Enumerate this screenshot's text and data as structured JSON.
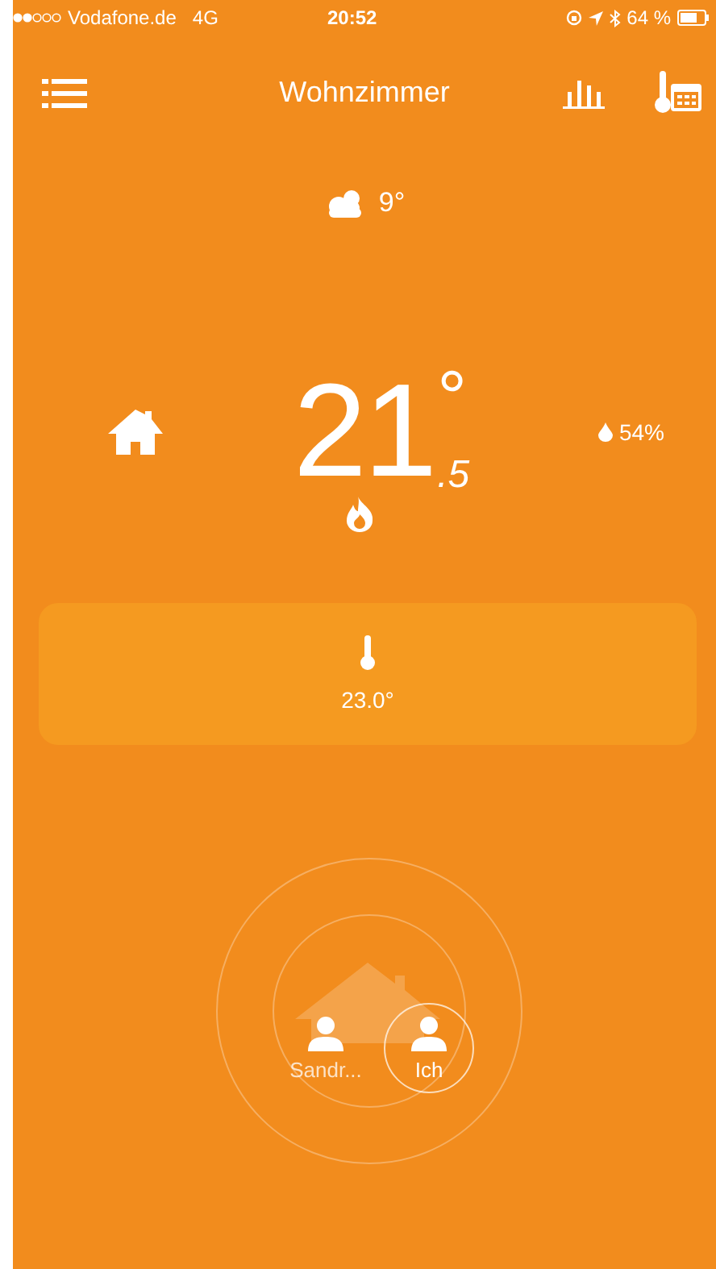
{
  "status_bar": {
    "carrier": "Vodafone.de",
    "network": "4G",
    "time": "20:52",
    "battery": "64 %"
  },
  "header": {
    "title": "Wohnzimmer"
  },
  "weather": {
    "temperature": "9°"
  },
  "room": {
    "temperature": "21",
    "decimal": ".5",
    "degree": "°",
    "humidity": "54%",
    "heating": true
  },
  "target": {
    "temperature": "23.0°"
  },
  "people": [
    {
      "name": "Sandr...",
      "selected": false
    },
    {
      "name": "Ich",
      "selected": true
    }
  ]
}
